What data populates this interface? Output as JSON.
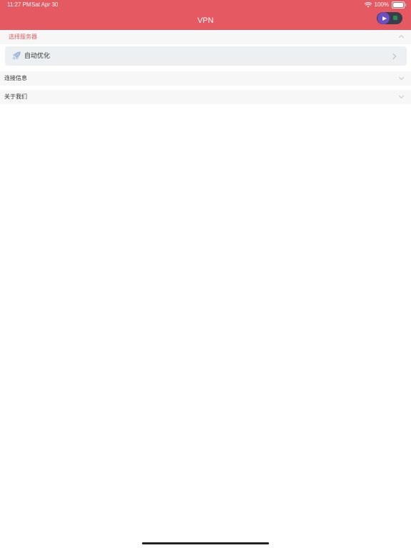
{
  "status_bar": {
    "time": "11:27 PM",
    "date": "Sat Apr 30",
    "battery": "100%"
  },
  "navbar": {
    "title": "VPN",
    "vpn_switch": {
      "state": "off",
      "icons": [
        "play-icon",
        "stop-icon"
      ]
    }
  },
  "sections": [
    {
      "label": "选择服务器",
      "expanded": true,
      "label_color": "#e55a62",
      "items": [
        {
          "label": "自动优化",
          "icon": "rocket-icon"
        }
      ]
    },
    {
      "label": "连接信息",
      "expanded": false,
      "label_color": "#333333"
    },
    {
      "label": "关于我们",
      "expanded": false,
      "label_color": "#333333"
    }
  ],
  "colors": {
    "accent": "#e55a62",
    "section_bg": "#f7f7f8",
    "row_bg": "#edf0f2"
  }
}
